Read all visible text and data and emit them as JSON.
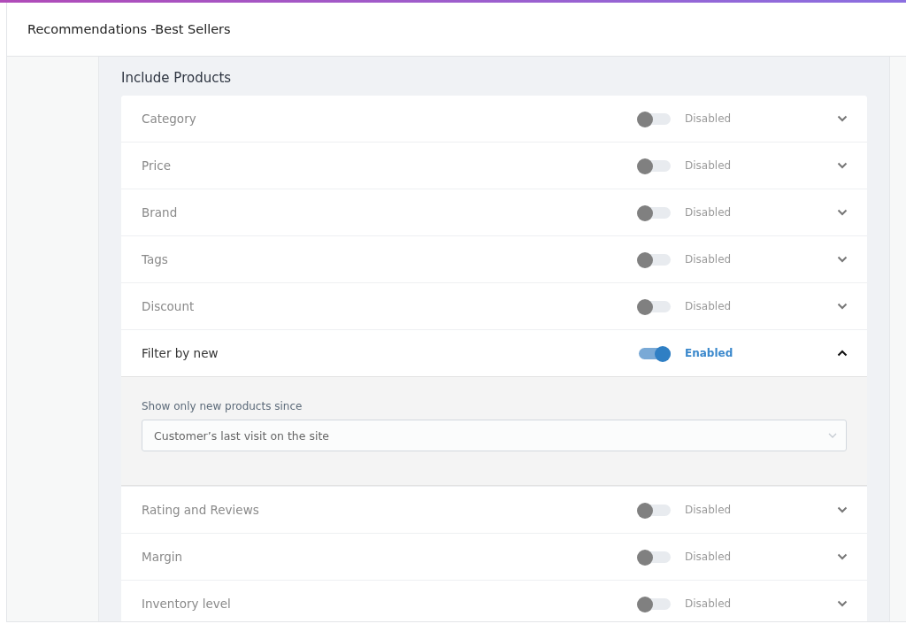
{
  "header": {
    "title": "Recommendations -Best Sellers"
  },
  "section": {
    "title": "Include Products"
  },
  "filters": [
    {
      "label": "Category",
      "enabled": false,
      "status": "Disabled",
      "expanded": false
    },
    {
      "label": "Price",
      "enabled": false,
      "status": "Disabled",
      "expanded": false
    },
    {
      "label": "Brand",
      "enabled": false,
      "status": "Disabled",
      "expanded": false
    },
    {
      "label": "Tags",
      "enabled": false,
      "status": "Disabled",
      "expanded": false
    },
    {
      "label": "Discount",
      "enabled": false,
      "status": "Disabled",
      "expanded": false
    },
    {
      "label": "Filter by new",
      "enabled": true,
      "status": "Enabled",
      "expanded": true,
      "detail": {
        "label": "Show only new products since",
        "value": "Customer’s last visit on the site"
      }
    },
    {
      "label": "Rating and Reviews",
      "enabled": false,
      "status": "Disabled",
      "expanded": false
    },
    {
      "label": "Margin",
      "enabled": false,
      "status": "Disabled",
      "expanded": false
    },
    {
      "label": "Inventory level",
      "enabled": false,
      "status": "Disabled",
      "expanded": false
    }
  ]
}
